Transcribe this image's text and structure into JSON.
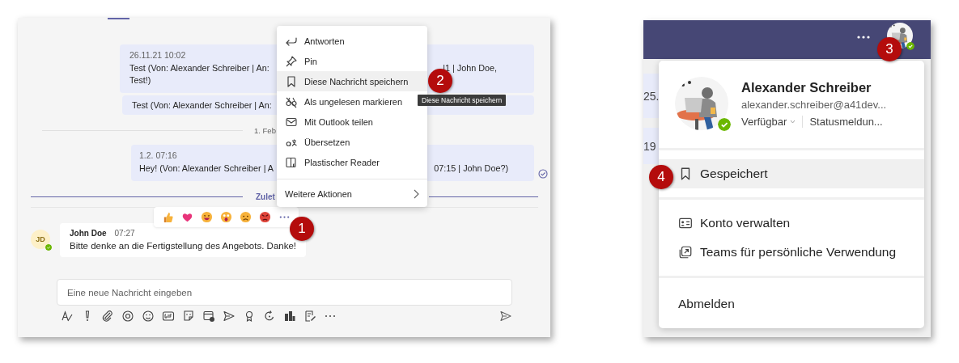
{
  "chat": {
    "messages": [
      {
        "kind": "bubble",
        "timestamp": "26.11.21 10:02",
        "lines": [
          {
            "left": "Test (Von: Alexander Schreiber | An:",
            "right": "|1 | John Doe,"
          },
          {
            "left": "Test!)"
          }
        ],
        "read": false
      },
      {
        "kind": "quote",
        "lines": [
          {
            "left": "Test (Von: Alexander Schreiber | An:"
          }
        ],
        "read": false
      },
      {
        "kind": "date",
        "label": "1. Feb"
      },
      {
        "kind": "bubble",
        "timestamp": "1.2. 07:16",
        "lines": [
          {
            "left": "Hey! (Von: Alexander Schreiber | A",
            "right": "07:15 | John Doe?)"
          }
        ],
        "read": true
      },
      {
        "kind": "new",
        "label": "Zulet"
      }
    ],
    "incoming": {
      "initials": "JD",
      "author": "John Doe",
      "time": "07:27",
      "text": "Bitte denke an die Fertigstellung des Angebots. Danke!"
    },
    "compose": {
      "placeholder": "Eine neue Nachricht eingeben"
    },
    "context_menu": {
      "items": [
        {
          "kind": "reply",
          "label": "Antworten",
          "selected": false
        },
        {
          "kind": "pin",
          "label": "Pin",
          "selected": false
        },
        {
          "kind": "bookmark",
          "label": "Diese Nachricht speichern",
          "selected": true
        },
        {
          "kind": "unread",
          "label": "Als ungelesen markieren",
          "selected": false
        },
        {
          "kind": "mail",
          "label": "Mit Outlook teilen",
          "selected": false
        },
        {
          "kind": "translate",
          "label": "Übersetzen",
          "selected": false
        },
        {
          "kind": "reader",
          "label": "Plastischer Reader",
          "selected": false
        }
      ],
      "more": "Weitere Aktionen"
    },
    "tooltip": "Diese Nachricht speichern"
  },
  "profile": {
    "background_rows": [
      "25.",
      "19"
    ],
    "name": "Alexander Schreiber",
    "email": "alexander.schreiber@a41dev...",
    "availability": "Verfügbar",
    "status_message": "Statusmeldun...",
    "sections": [
      [
        {
          "kind": "bookmark",
          "label": "Gespeichert",
          "selected": true
        }
      ],
      [
        {
          "kind": "id-card",
          "label": "Konto verwalten",
          "selected": false
        },
        {
          "kind": "external",
          "label": "Teams für persönliche Verwendung",
          "selected": false
        }
      ],
      [
        {
          "kind": "plain",
          "label": "Abmelden",
          "selected": false
        }
      ]
    ]
  },
  "annotations": [
    {
      "label": "1"
    },
    {
      "label": "2"
    },
    {
      "label": "3"
    },
    {
      "label": "4"
    }
  ]
}
